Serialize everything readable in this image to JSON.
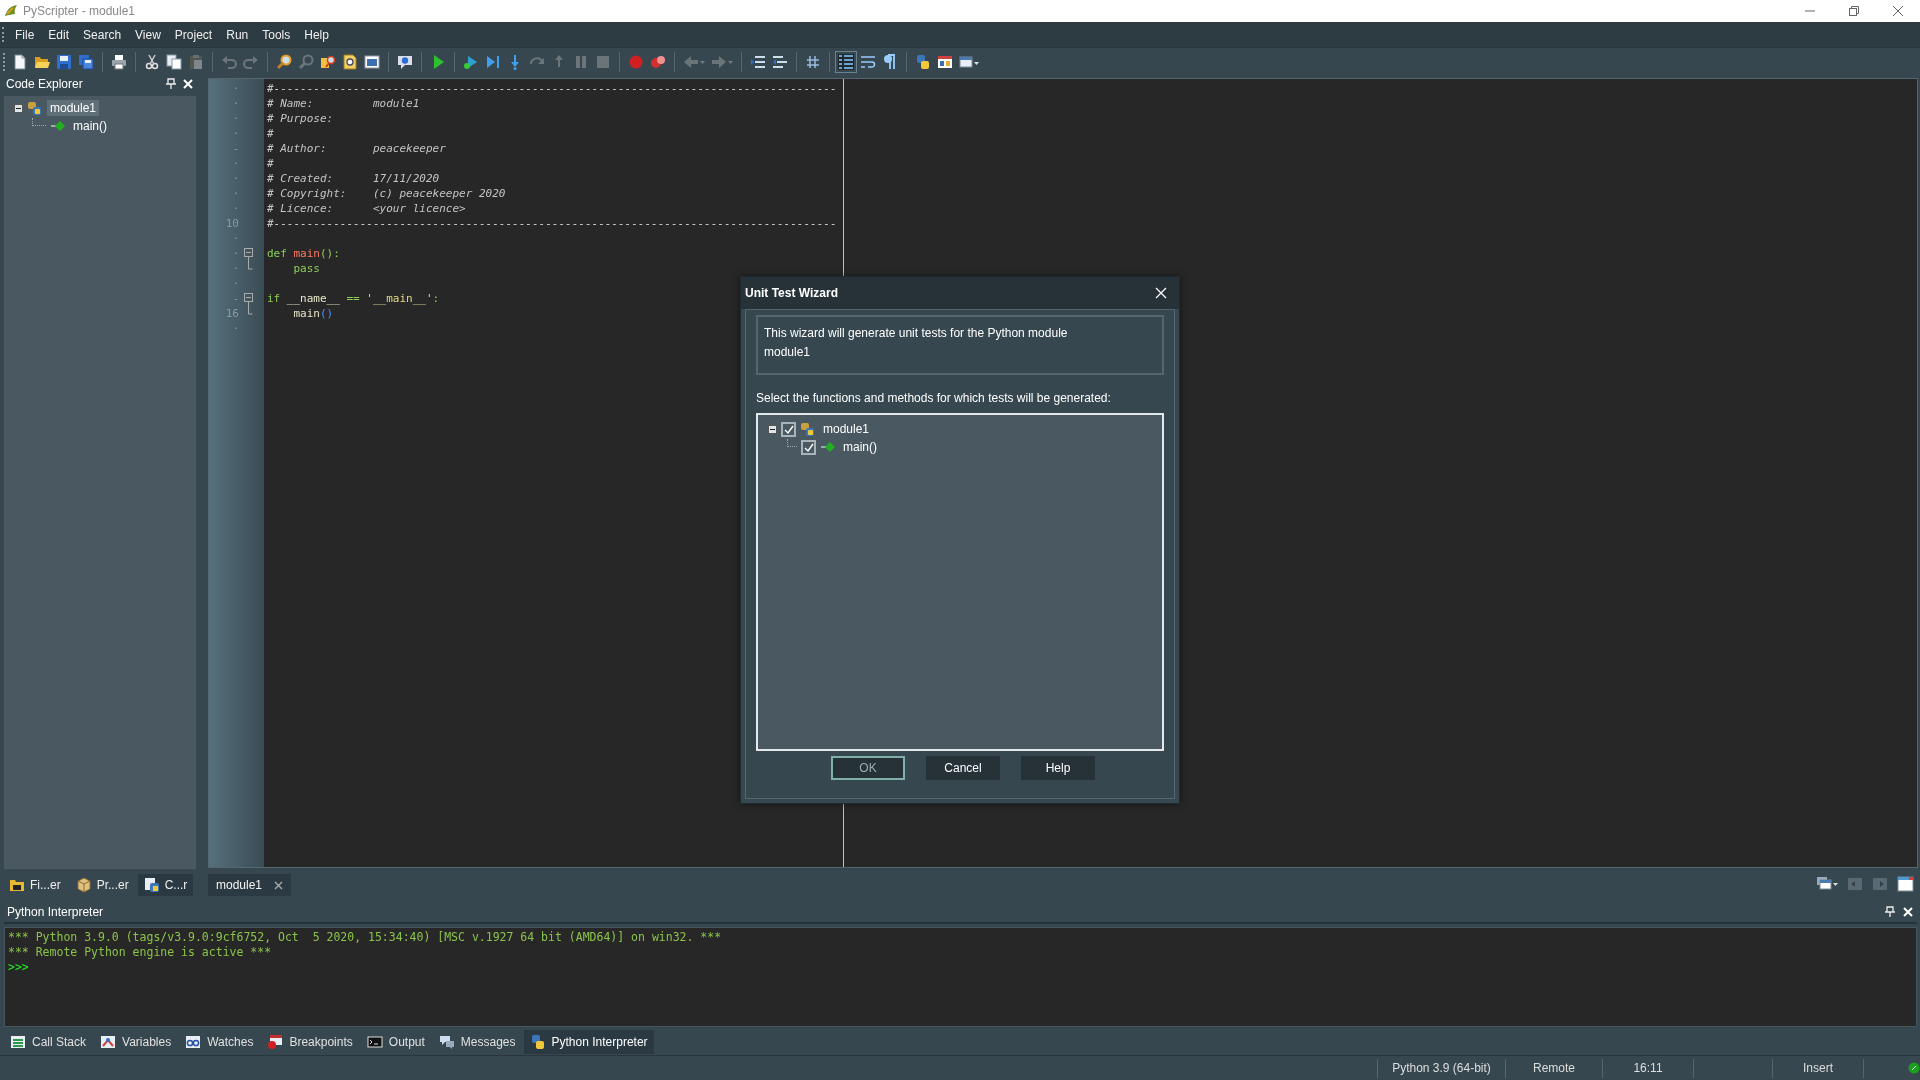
{
  "window": {
    "title": "PyScripter - module1"
  },
  "menu": [
    "File",
    "Edit",
    "Search",
    "View",
    "Project",
    "Run",
    "Tools",
    "Help"
  ],
  "code_explorer": {
    "title": "Code Explorer",
    "tree": [
      {
        "label": "module1",
        "kind": "module",
        "expanded": true,
        "selected": true,
        "children": [
          {
            "label": "main()",
            "kind": "function",
            "selected": false
          }
        ]
      }
    ]
  },
  "side_tabs": [
    {
      "label": "Fi...er",
      "kind": "files",
      "selected": false
    },
    {
      "label": "Pr...er",
      "kind": "project",
      "selected": false
    },
    {
      "label": "C...r",
      "kind": "code",
      "selected": true
    }
  ],
  "editor": {
    "lines": [
      {
        "gutter": "·",
        "tokens": [
          {
            "kind": "comment",
            "text": "#-------------------------------------------------------------------------------------"
          }
        ]
      },
      {
        "gutter": "·",
        "tokens": [
          {
            "kind": "comment",
            "text": "# Name:         module1"
          }
        ]
      },
      {
        "gutter": "·",
        "tokens": [
          {
            "kind": "comment",
            "text": "# Purpose:"
          }
        ]
      },
      {
        "gutter": "·",
        "tokens": [
          {
            "kind": "comment",
            "text": "#"
          }
        ]
      },
      {
        "gutter": "-",
        "tokens": [
          {
            "kind": "comment",
            "text": "# Author:       peacekeeper"
          }
        ]
      },
      {
        "gutter": "·",
        "tokens": [
          {
            "kind": "comment",
            "text": "#"
          }
        ]
      },
      {
        "gutter": "·",
        "tokens": [
          {
            "kind": "comment",
            "text": "# Created:      17/11/2020"
          }
        ]
      },
      {
        "gutter": "·",
        "tokens": [
          {
            "kind": "comment",
            "text": "# Copyright:    (c) peacekeeper 2020"
          }
        ]
      },
      {
        "gutter": "·",
        "tokens": [
          {
            "kind": "comment",
            "text": "# Licence:      <your licence>"
          }
        ]
      },
      {
        "gutter": "10",
        "tokens": [
          {
            "kind": "comment",
            "text": "#-------------------------------------------------------------------------------------"
          }
        ]
      },
      {
        "gutter": "·"
      },
      {
        "gutter": "·",
        "kind": "fold_start",
        "tokens": [
          {
            "kind": "keyword",
            "text": "def"
          },
          {
            "kind": "name",
            "text": " main"
          },
          {
            "kind": "keyword",
            "text": "():"
          }
        ]
      },
      {
        "gutter": "·",
        "kind": "fold_end",
        "tokens": [
          {
            "kind": "keyword",
            "text": "    pass"
          }
        ]
      },
      {
        "gutter": "·"
      },
      {
        "gutter": "-",
        "kind": "fold_start",
        "tokens": [
          {
            "kind": "keyword",
            "text": "if"
          },
          {
            "kind": "plain",
            "text": " __name__ "
          },
          {
            "kind": "keyword",
            "text": "=="
          },
          {
            "kind": "string",
            "text": " '__main__'"
          },
          {
            "kind": "keyword",
            "text": ":"
          }
        ]
      },
      {
        "gutter": "16",
        "kind": "fold_end",
        "tokens": [
          {
            "kind": "plain",
            "text": "    main"
          },
          {
            "kind": "bracket",
            "text": "()"
          }
        ]
      },
      {
        "gutter": "·"
      }
    ]
  },
  "editor_tabs": [
    {
      "label": "module1",
      "selected": true
    }
  ],
  "interpreter": {
    "title": "Python Interpreter",
    "lines": [
      {
        "kind": "banner",
        "text": "*** Python 3.9.0 (tags/v3.9.0:9cf6752, Oct  5 2020, 15:34:40) [MSC v.1927 64 bit (AMD64)] on win32. ***"
      },
      {
        "kind": "banner",
        "text": "*** Remote Python engine is active ***"
      },
      {
        "kind": "prompt",
        "text": ">>>"
      }
    ]
  },
  "bottom_tabs": [
    {
      "label": "Call Stack",
      "kind": "callstack",
      "selected": false
    },
    {
      "label": "Variables",
      "kind": "variables",
      "selected": false
    },
    {
      "label": "Watches",
      "kind": "watches",
      "selected": false
    },
    {
      "label": "Breakpoints",
      "kind": "breakpoints",
      "selected": false
    },
    {
      "label": "Output",
      "kind": "output",
      "selected": false
    },
    {
      "label": "Messages",
      "kind": "messages",
      "selected": false
    },
    {
      "label": "Python Interpreter",
      "kind": "python",
      "selected": true
    }
  ],
  "status_bar": {
    "cells": [
      "Python 3.9 (64-bit)",
      "Remote",
      "16:11",
      "Insert"
    ]
  },
  "dialog": {
    "title": "Unit Test Wizard",
    "intro": "This wizard will generate unit tests for the Python module",
    "module": "module1",
    "prompt": "Select the functions and methods for which tests will be generated:",
    "tree": [
      {
        "label": "module1",
        "kind": "module",
        "checked": true,
        "expanded": true,
        "children": [
          {
            "label": "main()",
            "kind": "function",
            "checked": true
          }
        ]
      }
    ],
    "buttons": [
      {
        "label": "OK",
        "default": true
      },
      {
        "label": "Cancel",
        "default": false
      },
      {
        "label": "Help",
        "default": false
      }
    ]
  }
}
